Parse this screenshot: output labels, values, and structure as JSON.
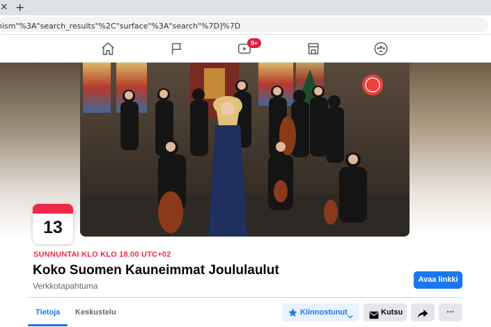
{
  "browser": {
    "tab_close_glyph": "×",
    "tab_new_glyph": "+",
    "url_fragment": "nism\"%3A\"search_results\"%2C\"surface\"%3A\"search\"%7D]%7D"
  },
  "fb_nav": {
    "icons": [
      "home-icon",
      "pages-flag-icon",
      "watch-video-icon",
      "marketplace-icon",
      "groups-icon"
    ],
    "watch_badge": "9+"
  },
  "event": {
    "calendar_day": "13",
    "datetime": "SUNNUNTAI KLO KLO 18.00 UTC+02",
    "title": "Koko Suomen Kauneimmat Joululaulut",
    "subtitle": "Verkkotapahtuma",
    "open_link_label": "Avaa linkki"
  },
  "tabs": [
    {
      "label": "Tietoja",
      "active": true
    },
    {
      "label": "Keskustelu",
      "active": false
    }
  ],
  "actions": {
    "interested_label": "Kiinnostunut",
    "invite_label": "Kutsu",
    "more_glyph": "···"
  },
  "colors": {
    "accent": "#1877f2",
    "date_red": "#f02849",
    "badge_red": "#e41e3f"
  }
}
